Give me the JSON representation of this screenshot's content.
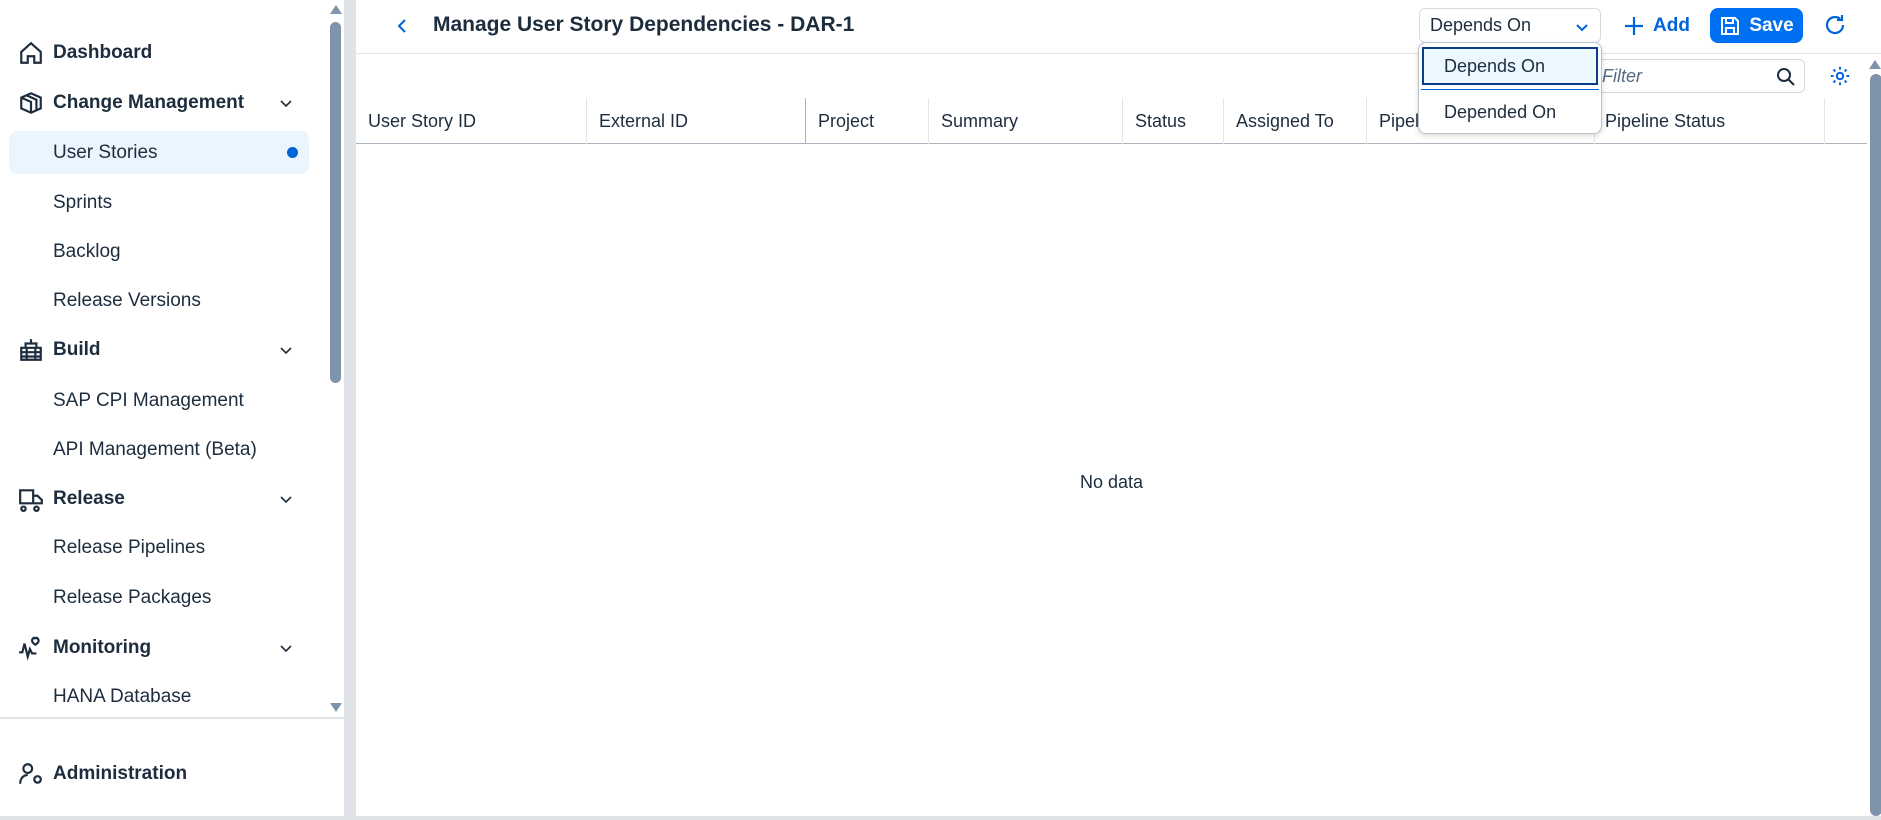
{
  "sidebar": {
    "dashboard": "Dashboard",
    "change_management": "Change Management",
    "user_stories": "User Stories",
    "sprints": "Sprints",
    "backlog": "Backlog",
    "release_versions": "Release Versions",
    "build": "Build",
    "sap_cpi": "SAP CPI Management",
    "api_mgmt": "API Management (Beta)",
    "release": "Release",
    "release_pipelines": "Release Pipelines",
    "release_packages": "Release Packages",
    "monitoring": "Monitoring",
    "hana": "HANA Database",
    "administration": "Administration"
  },
  "header": {
    "title": "Manage User Story Dependencies - DAR-1",
    "select_value": "Depends On",
    "add_label": "Add",
    "save_label": "Save"
  },
  "dropdown": {
    "options": [
      "Depends On",
      "Depended On"
    ]
  },
  "search": {
    "placeholder": "Filter"
  },
  "table": {
    "columns": [
      "User Story ID",
      "External ID",
      "Project",
      "Summary",
      "Status",
      "Assigned To",
      "Pipeline",
      "Pipeline Status"
    ],
    "empty": "No data"
  },
  "colors": {
    "accent": "#0070f2",
    "text": "#1d2d3e"
  }
}
